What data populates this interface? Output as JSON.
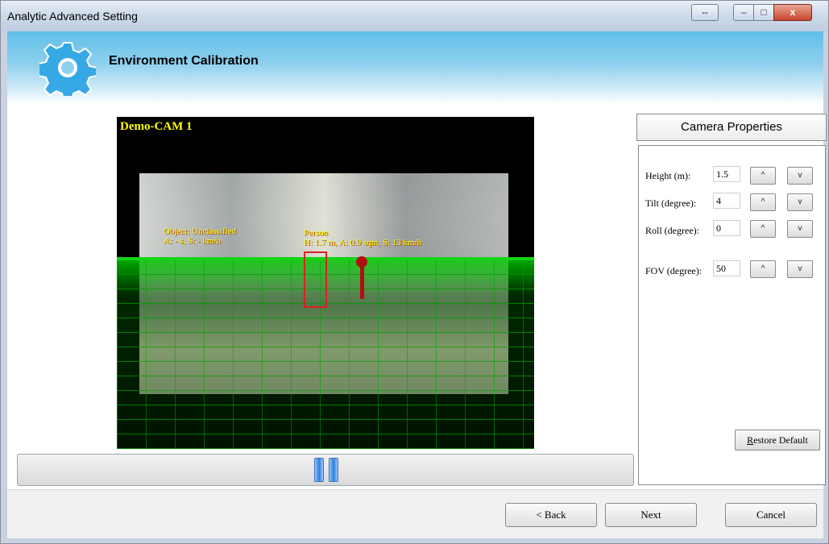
{
  "window": {
    "title": "Analytic Advanced Setting",
    "close_glyph": "x",
    "min_glyph": "–",
    "max_glyph": "□",
    "restore_glyph": "⇔"
  },
  "header": {
    "title": "Environment Calibration",
    "icon": "gear-icon",
    "icon_color": "#37a8e6"
  },
  "video": {
    "camera_label": "Demo-CAM 1",
    "objects": [
      {
        "line1": "Object: Unclassified",
        "line2": "A: - s, S: - km/h"
      },
      {
        "line1": "Person",
        "line2": "H: 1.7 m, A: 0.9 sqm, S: 13 km/h"
      }
    ],
    "grid_color": "#00c000",
    "marker_color": "#b01010"
  },
  "properties": {
    "title": "Camera Properties",
    "fields": [
      {
        "label": "Height (m):",
        "value": "1.5"
      },
      {
        "label": "Tilt (degree):",
        "value": "4"
      },
      {
        "label": "Roll (degree):",
        "value": "0"
      },
      {
        "label": "FOV (degree):",
        "value": "50"
      }
    ],
    "up_label": "^",
    "down_label": "v",
    "restore_first": "R",
    "restore_rest": "estore Default"
  },
  "footer": {
    "back": "< Back",
    "next": "Next",
    "cancel": "Cancel"
  }
}
